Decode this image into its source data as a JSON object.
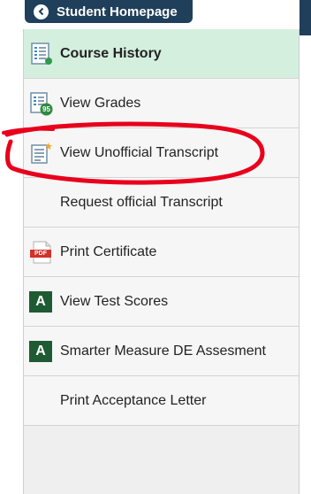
{
  "header": {
    "back_title": "Student Homepage"
  },
  "menu": {
    "items": [
      {
        "label": "Course History"
      },
      {
        "label": "View Grades"
      },
      {
        "label": "View Unofficial Transcript"
      },
      {
        "label": "Request official Transcript"
      },
      {
        "label": "Print Certificate"
      },
      {
        "label": "View Test Scores"
      },
      {
        "label": "Smarter Measure DE Assesment"
      },
      {
        "label": "Print Acceptance Letter"
      }
    ],
    "grades_badge": "95",
    "pdf_badge": "PDF",
    "test_icon_letter": "A"
  },
  "colors": {
    "header_bg": "#1f3f5b",
    "active_item_bg": "#d4efde",
    "annotation_red": "#e8001c",
    "test_icon_green": "#1e5a32"
  }
}
